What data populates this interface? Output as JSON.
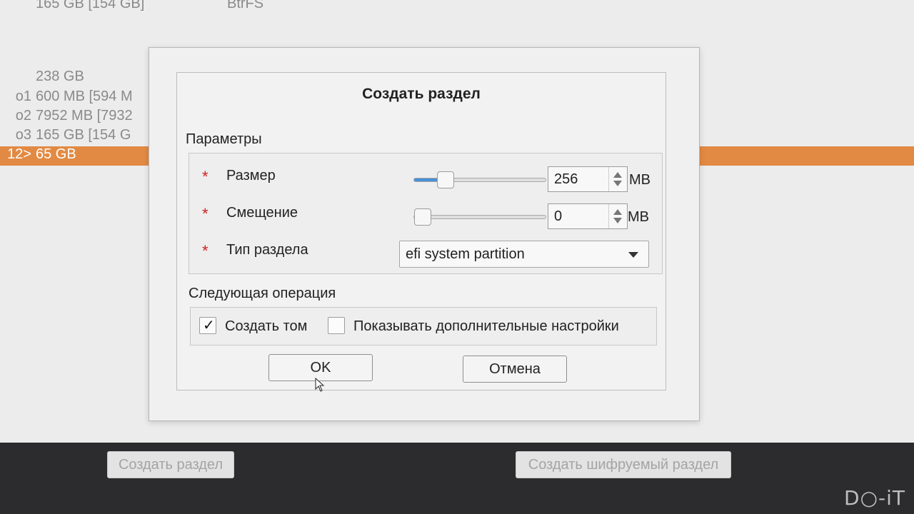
{
  "background": {
    "top_row": {
      "size": "165 GB [154 GB]",
      "fs": "BtrFS"
    },
    "rows": [
      {
        "idx": "",
        "size": "238 GB"
      },
      {
        "idx": "o1",
        "size": "600 MB [594 M"
      },
      {
        "idx": "o2",
        "size": "7952 MB [7932"
      },
      {
        "idx": "o3",
        "size": "165 GB [154 G"
      }
    ],
    "selected_row": {
      "idx": "12>",
      "size": "65 GB"
    },
    "selected_color": "#e28a44"
  },
  "bottom_bar": {
    "create_partition": "Создать раздел",
    "create_encrypted": "Создать шифруемый раздел",
    "logo": "D○-iT"
  },
  "dialog": {
    "title": "Создать раздел",
    "params_label": "Параметры",
    "required_mark": "*",
    "size": {
      "label": "Размер",
      "value": "256",
      "unit": "MB",
      "slider_fraction": 0.2
    },
    "offset": {
      "label": "Смещение",
      "value": "0",
      "unit": "MB",
      "slider_fraction": 0.0
    },
    "type": {
      "label": "Тип раздела",
      "value": "efi system partition"
    },
    "next_op_label": "Следующая операция",
    "create_volume": {
      "label": "Создать том",
      "checked": true,
      "mark": "✓"
    },
    "show_advanced": {
      "label": "Показывать дополнительные настройки",
      "checked": false
    },
    "ok": "OK",
    "cancel": "Отмена"
  },
  "colors": {
    "slider_fill": "#4a8fd8",
    "required": "#d21f1f"
  }
}
